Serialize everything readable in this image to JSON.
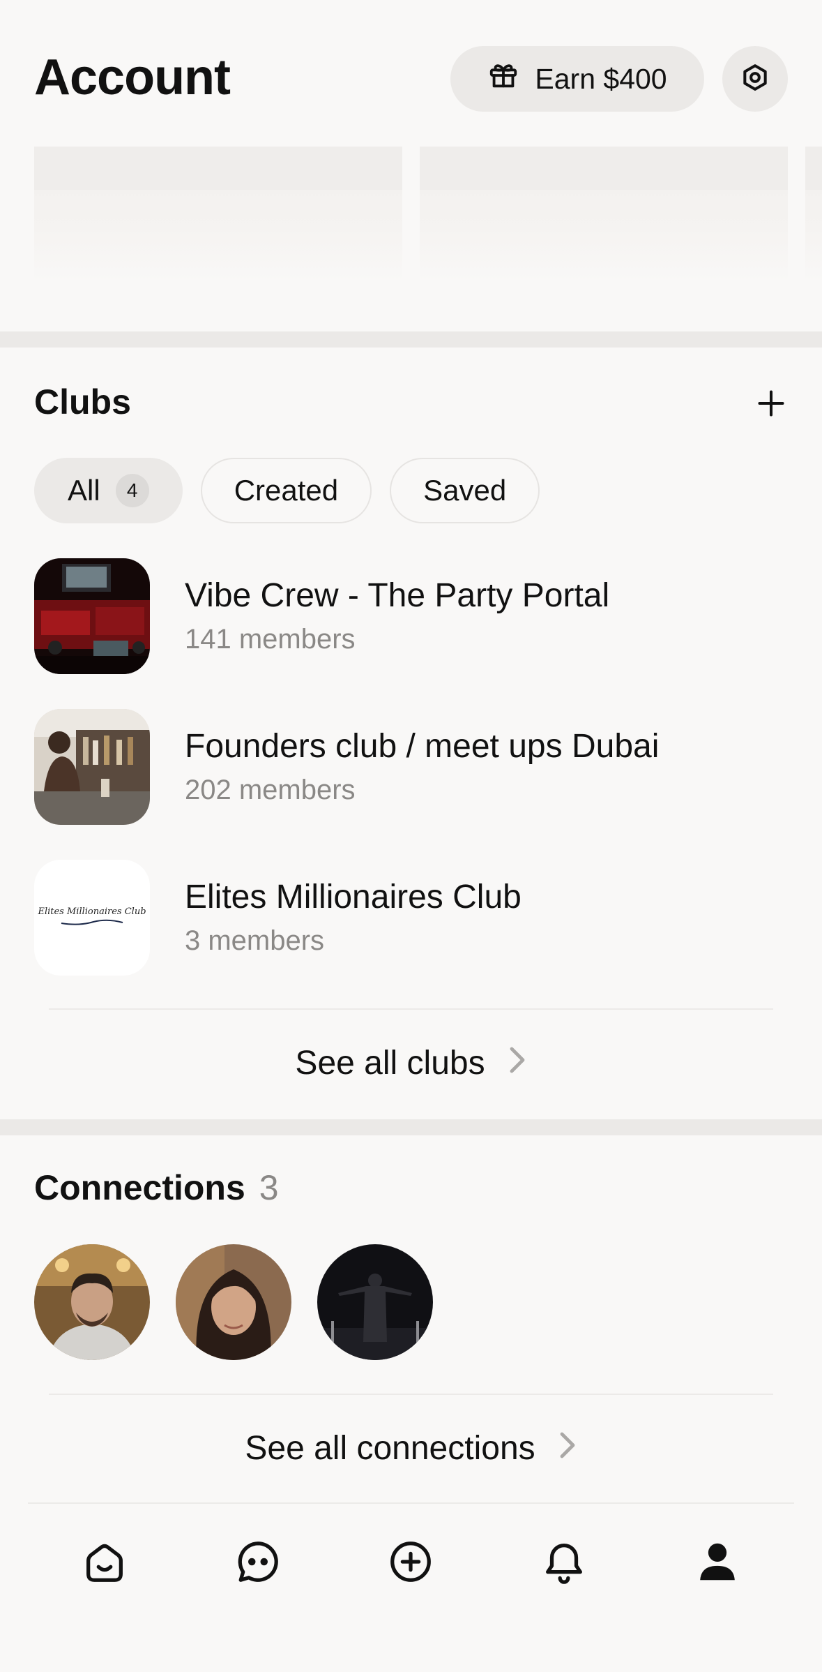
{
  "header": {
    "title": "Account",
    "earn_label": "Earn $400",
    "earn_icon": "gift-icon",
    "settings_icon": "gear-icon"
  },
  "clubs": {
    "title": "Clubs",
    "add_icon": "plus-icon",
    "filters": [
      {
        "label": "All",
        "count": "4",
        "selected": true
      },
      {
        "label": "Created"
      },
      {
        "label": "Saved"
      }
    ],
    "items": [
      {
        "name": "Vibe Crew - The Party Portal",
        "members": "141 members"
      },
      {
        "name": "Founders club / meet ups Dubai",
        "members": "202 members"
      },
      {
        "name": "Elites Millionaires Club",
        "members": "3 members",
        "logo_text": "Elites Millionaires Club"
      }
    ],
    "see_all": "See all clubs"
  },
  "connections": {
    "title": "Connections",
    "count": "3",
    "see_all": "See all connections"
  },
  "tabbar": {
    "items": [
      "home-icon",
      "chat-icon",
      "create-icon",
      "notifications-icon",
      "profile-icon"
    ],
    "active": "profile-icon"
  },
  "colors": {
    "background": "#f9f8f7",
    "pill": "#ebe9e7",
    "muted_text": "#8a8886"
  }
}
